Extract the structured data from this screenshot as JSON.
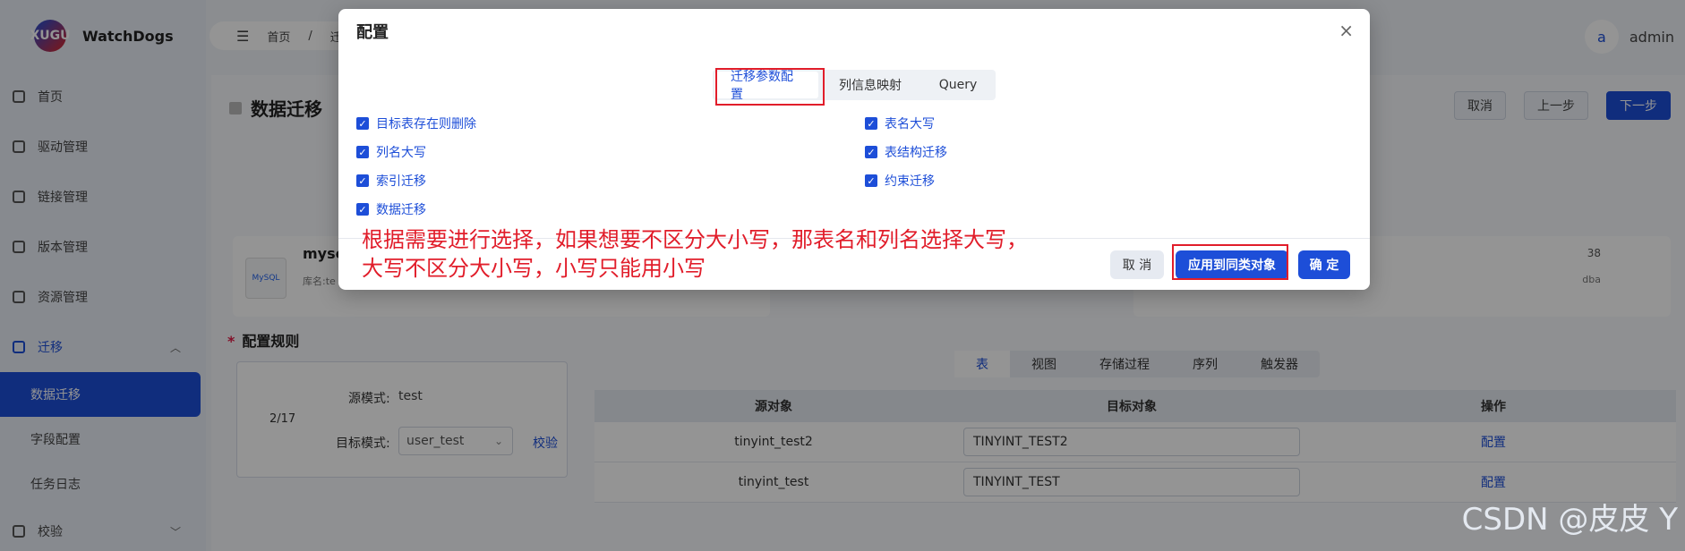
{
  "app": {
    "name": "WatchDogs",
    "logo_text": "XUGU"
  },
  "topbar": {
    "breadcrumb": [
      "首页",
      "/",
      "迁"
    ]
  },
  "user": {
    "avatar_letter": "a",
    "name": "admin"
  },
  "sidebar": {
    "items": [
      {
        "label": "首页"
      },
      {
        "label": "驱动管理"
      },
      {
        "label": "链接管理"
      },
      {
        "label": "版本管理"
      },
      {
        "label": "资源管理"
      },
      {
        "label": "迁移"
      },
      {
        "label": "数据迁移"
      },
      {
        "label": "字段配置"
      },
      {
        "label": "任务日志"
      },
      {
        "label": "校验"
      }
    ]
  },
  "page": {
    "title": "数据迁移",
    "actions": {
      "cancel": "取消",
      "prev": "上一步",
      "next": "下一步"
    },
    "source": {
      "name": "mysc",
      "lib": "库名:te",
      "icon_text": "MySQL"
    },
    "target": {
      "num": "38",
      "db": "dba"
    },
    "rule_title": "配置规则",
    "rule_required": "*",
    "mode": {
      "count": "2/17",
      "src_label": "源模式:",
      "src_value": "test",
      "tgt_label": "目标模式:",
      "tgt_value": "user_test",
      "check_link": "校验"
    },
    "object_tabs": [
      "表",
      "视图",
      "存储过程",
      "序列",
      "触发器"
    ],
    "table": {
      "headers": [
        "源对象",
        "目标对象",
        "操作"
      ],
      "rows": [
        {
          "src": "tinyint_test2",
          "tgt": "TINYINT_TEST2",
          "op": "配置"
        },
        {
          "src": "tinyint_test",
          "tgt": "TINYINT_TEST",
          "op": "配置"
        }
      ]
    }
  },
  "modal": {
    "title": "配置",
    "close": "×",
    "tabs": [
      "迁移参数配置",
      "列信息映射",
      "Query"
    ],
    "checkboxes_left": [
      "目标表存在则删除",
      "列名大写",
      "索引迁移",
      "数据迁移"
    ],
    "checkboxes_right": [
      "表名大写",
      "表结构迁移",
      "约束迁移"
    ],
    "annotation": "根据需要进行选择，如果想要不区分大小写，那表名和列名选择大写，\n大写不区分大小写，小写只能用小写",
    "buttons": {
      "cancel": "取 消",
      "apply": "应用到同类对象",
      "ok": "确 定"
    }
  },
  "watermark": "CSDN @皮皮 Y",
  "colors": {
    "primary": "#1d4ed8",
    "annotation": "#e11d2a"
  }
}
